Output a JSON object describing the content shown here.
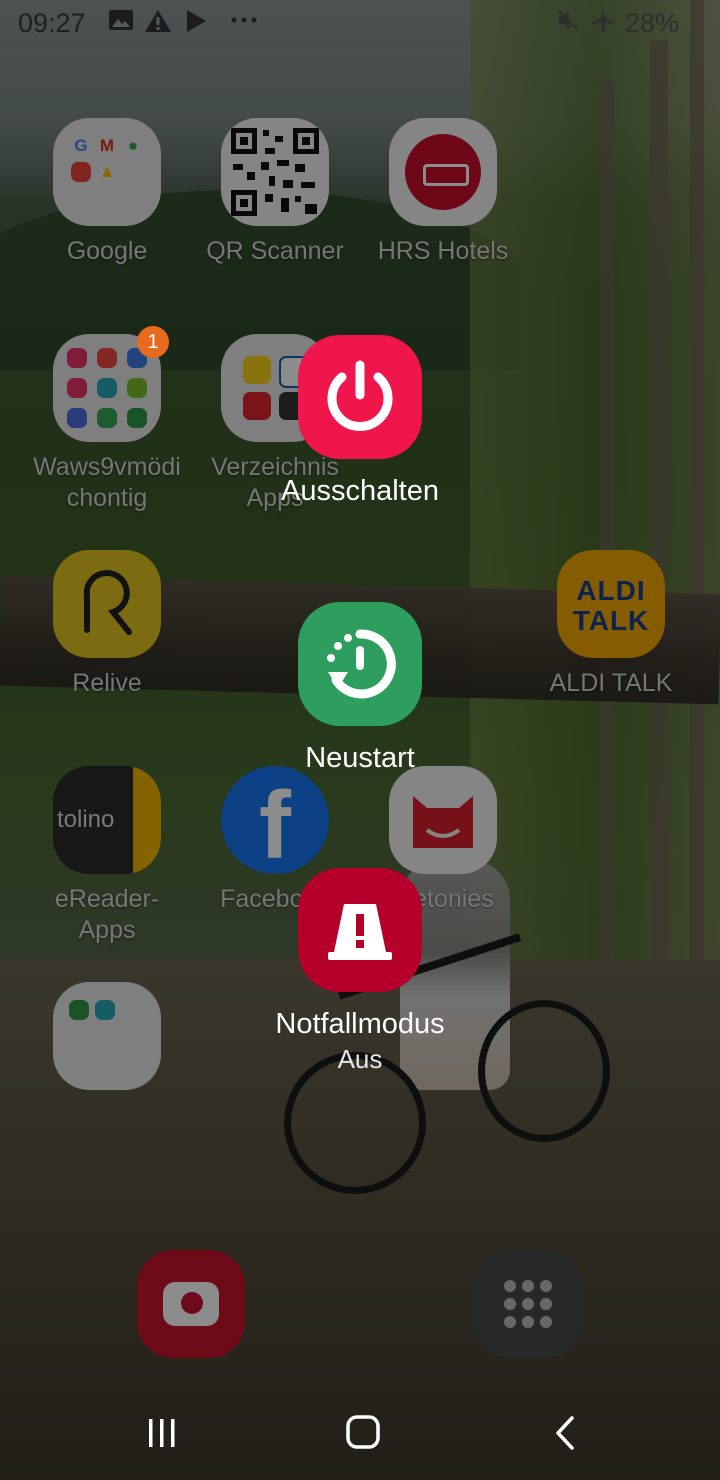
{
  "status_bar": {
    "time": "09:27",
    "icons": [
      "gallery-icon",
      "warning-icon",
      "play-store-icon",
      "more-icon"
    ],
    "battery": "28%"
  },
  "home_apps": [
    {
      "label": "Google"
    },
    {
      "label": "QR Scanner"
    },
    {
      "label": "HRS Hotels"
    },
    {
      "label": "Waws9vmödi chontig",
      "badge": "1"
    },
    {
      "label": "Verzeichnis Apps"
    },
    {
      "label": "Relive"
    },
    {
      "label": "ALDI TALK",
      "icon_text": "ALDI TALK"
    },
    {
      "label": "eReader-Apps",
      "icon_text": "tolino"
    },
    {
      "label": "Facebook"
    },
    {
      "label": "metonies"
    },
    {
      "label": ""
    }
  ],
  "power_menu": {
    "power_off": {
      "label": "Ausschalten",
      "color": "#f0164c"
    },
    "restart": {
      "label": "Neustart",
      "color": "#2e9e5e"
    },
    "emergency": {
      "label": "Notfallmodus",
      "status": "Aus",
      "color": "#b5002b"
    }
  },
  "nav_bar": {
    "recents": "recents-icon",
    "home": "home-icon",
    "back": "back-icon"
  }
}
